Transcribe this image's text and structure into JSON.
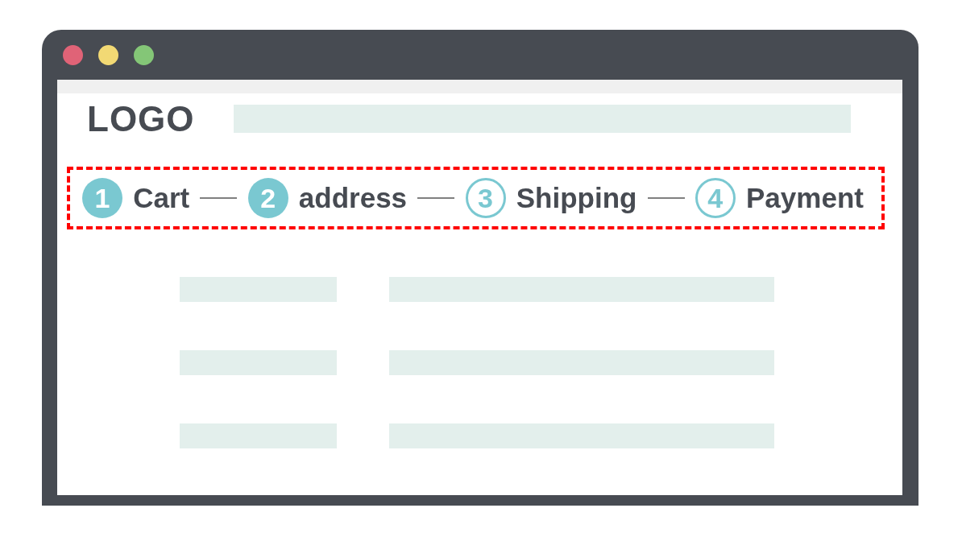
{
  "header": {
    "logo": "LOGO"
  },
  "progress_steps": {
    "highlighted": true,
    "steps": [
      {
        "number": "1",
        "label": "Cart",
        "completed": true
      },
      {
        "number": "2",
        "label": "address",
        "completed": true
      },
      {
        "number": "3",
        "label": "Shipping",
        "completed": false
      },
      {
        "number": "4",
        "label": "Payment",
        "completed": false
      }
    ]
  }
}
